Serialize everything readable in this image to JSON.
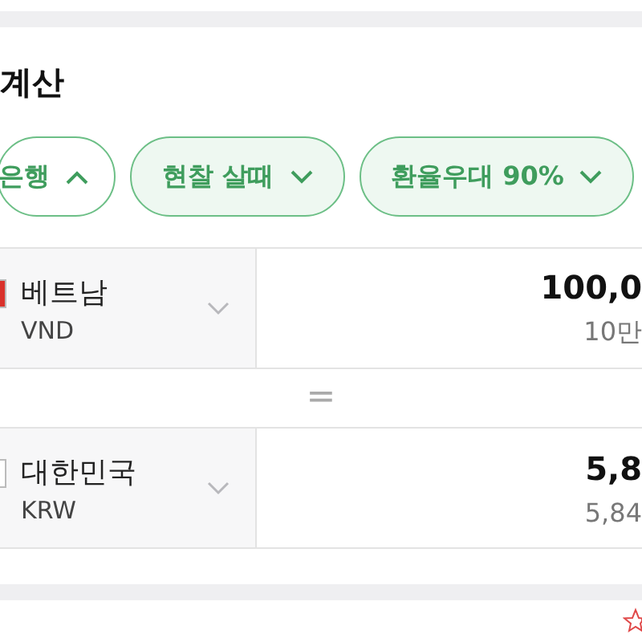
{
  "title": "계산",
  "chips": [
    {
      "label": "은행",
      "expanded": true
    },
    {
      "label": "현찰 살때",
      "expanded": false
    },
    {
      "label": "환율우대 90%",
      "expanded": false
    }
  ],
  "currencies": [
    {
      "country": "베트남",
      "code": "VND",
      "color": "#d9312b",
      "amount": "100,0",
      "amount_words": "10만"
    },
    {
      "country": "대한민국",
      "code": "KRW",
      "color": "#ffffff",
      "amount": "5,8",
      "amount_words": "5,84"
    }
  ],
  "separator": "="
}
